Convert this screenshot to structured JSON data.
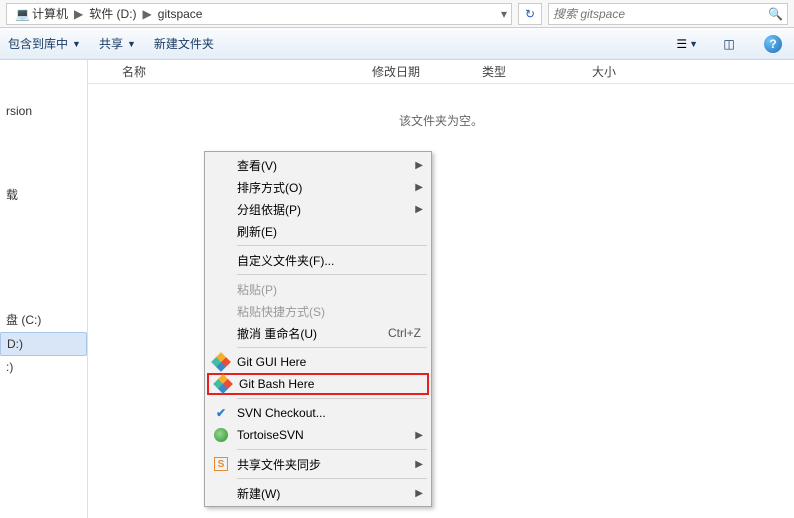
{
  "breadcrumbs": {
    "root": "计算机",
    "drive": "软件 (D:)",
    "folder": "gitspace"
  },
  "search": {
    "placeholder": "搜索 gitspace"
  },
  "toolbar": {
    "include": "包含到库中",
    "share": "共享",
    "newfolder": "新建文件夹"
  },
  "columns": {
    "name": "名称",
    "date": "修改日期",
    "type": "类型",
    "size": "大小"
  },
  "empty": "该文件夹为空。",
  "sidebar": {
    "items": [
      "rsion",
      "载",
      "盘 (C:)",
      "D:)",
      ":)"
    ]
  },
  "context_menu": {
    "view": "查看(V)",
    "sort": "排序方式(O)",
    "group": "分组依据(P)",
    "refresh": "刷新(E)",
    "customize": "自定义文件夹(F)...",
    "paste": "粘贴(P)",
    "paste_shortcut": "粘贴快捷方式(S)",
    "undo_label": "撤消 重命名(U)",
    "undo_shortcut": "Ctrl+Z",
    "git_gui": "Git GUI Here",
    "git_bash": "Git Bash Here",
    "svn_checkout": "SVN Checkout...",
    "tortoise": "TortoiseSVN",
    "sync": "共享文件夹同步",
    "new": "新建(W)"
  }
}
